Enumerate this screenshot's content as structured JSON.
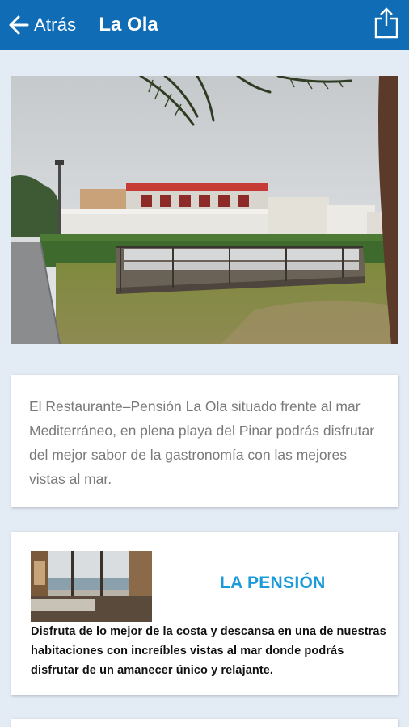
{
  "appbar": {
    "back_label": "Atrás",
    "title": "La Ola",
    "back_icon": "arrow-left-icon",
    "share_icon": "share-icon",
    "color": "#0f6cb5"
  },
  "intro": {
    "text": "El Restaurante–Pensión La Ola situado frente al mar Mediterráneo, en plena playa del Pinar podrás disfrutar del mejor sabor de la gastronomía con las mejores vistas al mar."
  },
  "pension": {
    "title": "LA PENSIÓN",
    "text": "Disfruta de lo mejor de la costa  y descansa en una de nuestras habitaciones con increíbles vistas al mar  donde podrás disfrutar de un amanecer único y relajante.",
    "title_color": "#1a9ad8"
  }
}
